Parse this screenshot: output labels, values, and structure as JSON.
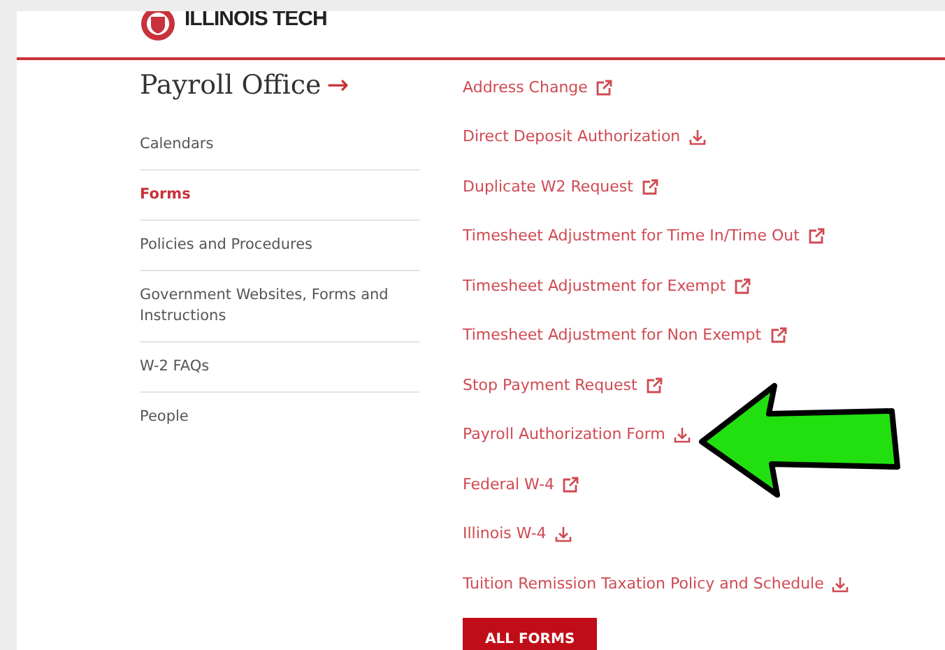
{
  "header": {
    "logo_text": "ILLINOIS TECH"
  },
  "sidebar": {
    "title": "Payroll Office",
    "title_icon": "→",
    "items": [
      {
        "label": "Calendars",
        "selected": false
      },
      {
        "label": "Forms",
        "selected": true
      },
      {
        "label": "Policies and Procedures",
        "selected": false
      },
      {
        "label": "Government Websites, Forms and Instructions",
        "selected": false
      },
      {
        "label": "W-2 FAQs",
        "selected": false
      },
      {
        "label": "People",
        "selected": false
      }
    ]
  },
  "links": [
    {
      "label": "Address Change",
      "kind": "external"
    },
    {
      "label": "Direct Deposit Authorization",
      "kind": "download"
    },
    {
      "label": "Duplicate W2 Request",
      "kind": "external"
    },
    {
      "label": "Timesheet Adjustment for Time In/Time Out",
      "kind": "external"
    },
    {
      "label": "Timesheet Adjustment for Exempt",
      "kind": "external"
    },
    {
      "label": "Timesheet Adjustment for Non Exempt",
      "kind": "external"
    },
    {
      "label": "Stop Payment Request",
      "kind": "external"
    },
    {
      "label": "Payroll Authorization Form",
      "kind": "download"
    },
    {
      "label": "Federal W-4",
      "kind": "external"
    },
    {
      "label": "Illinois W-4",
      "kind": "download"
    },
    {
      "label": "Tuition Remission Taxation Policy and Schedule",
      "kind": "download"
    }
  ],
  "button": {
    "label": "ALL FORMS"
  }
}
